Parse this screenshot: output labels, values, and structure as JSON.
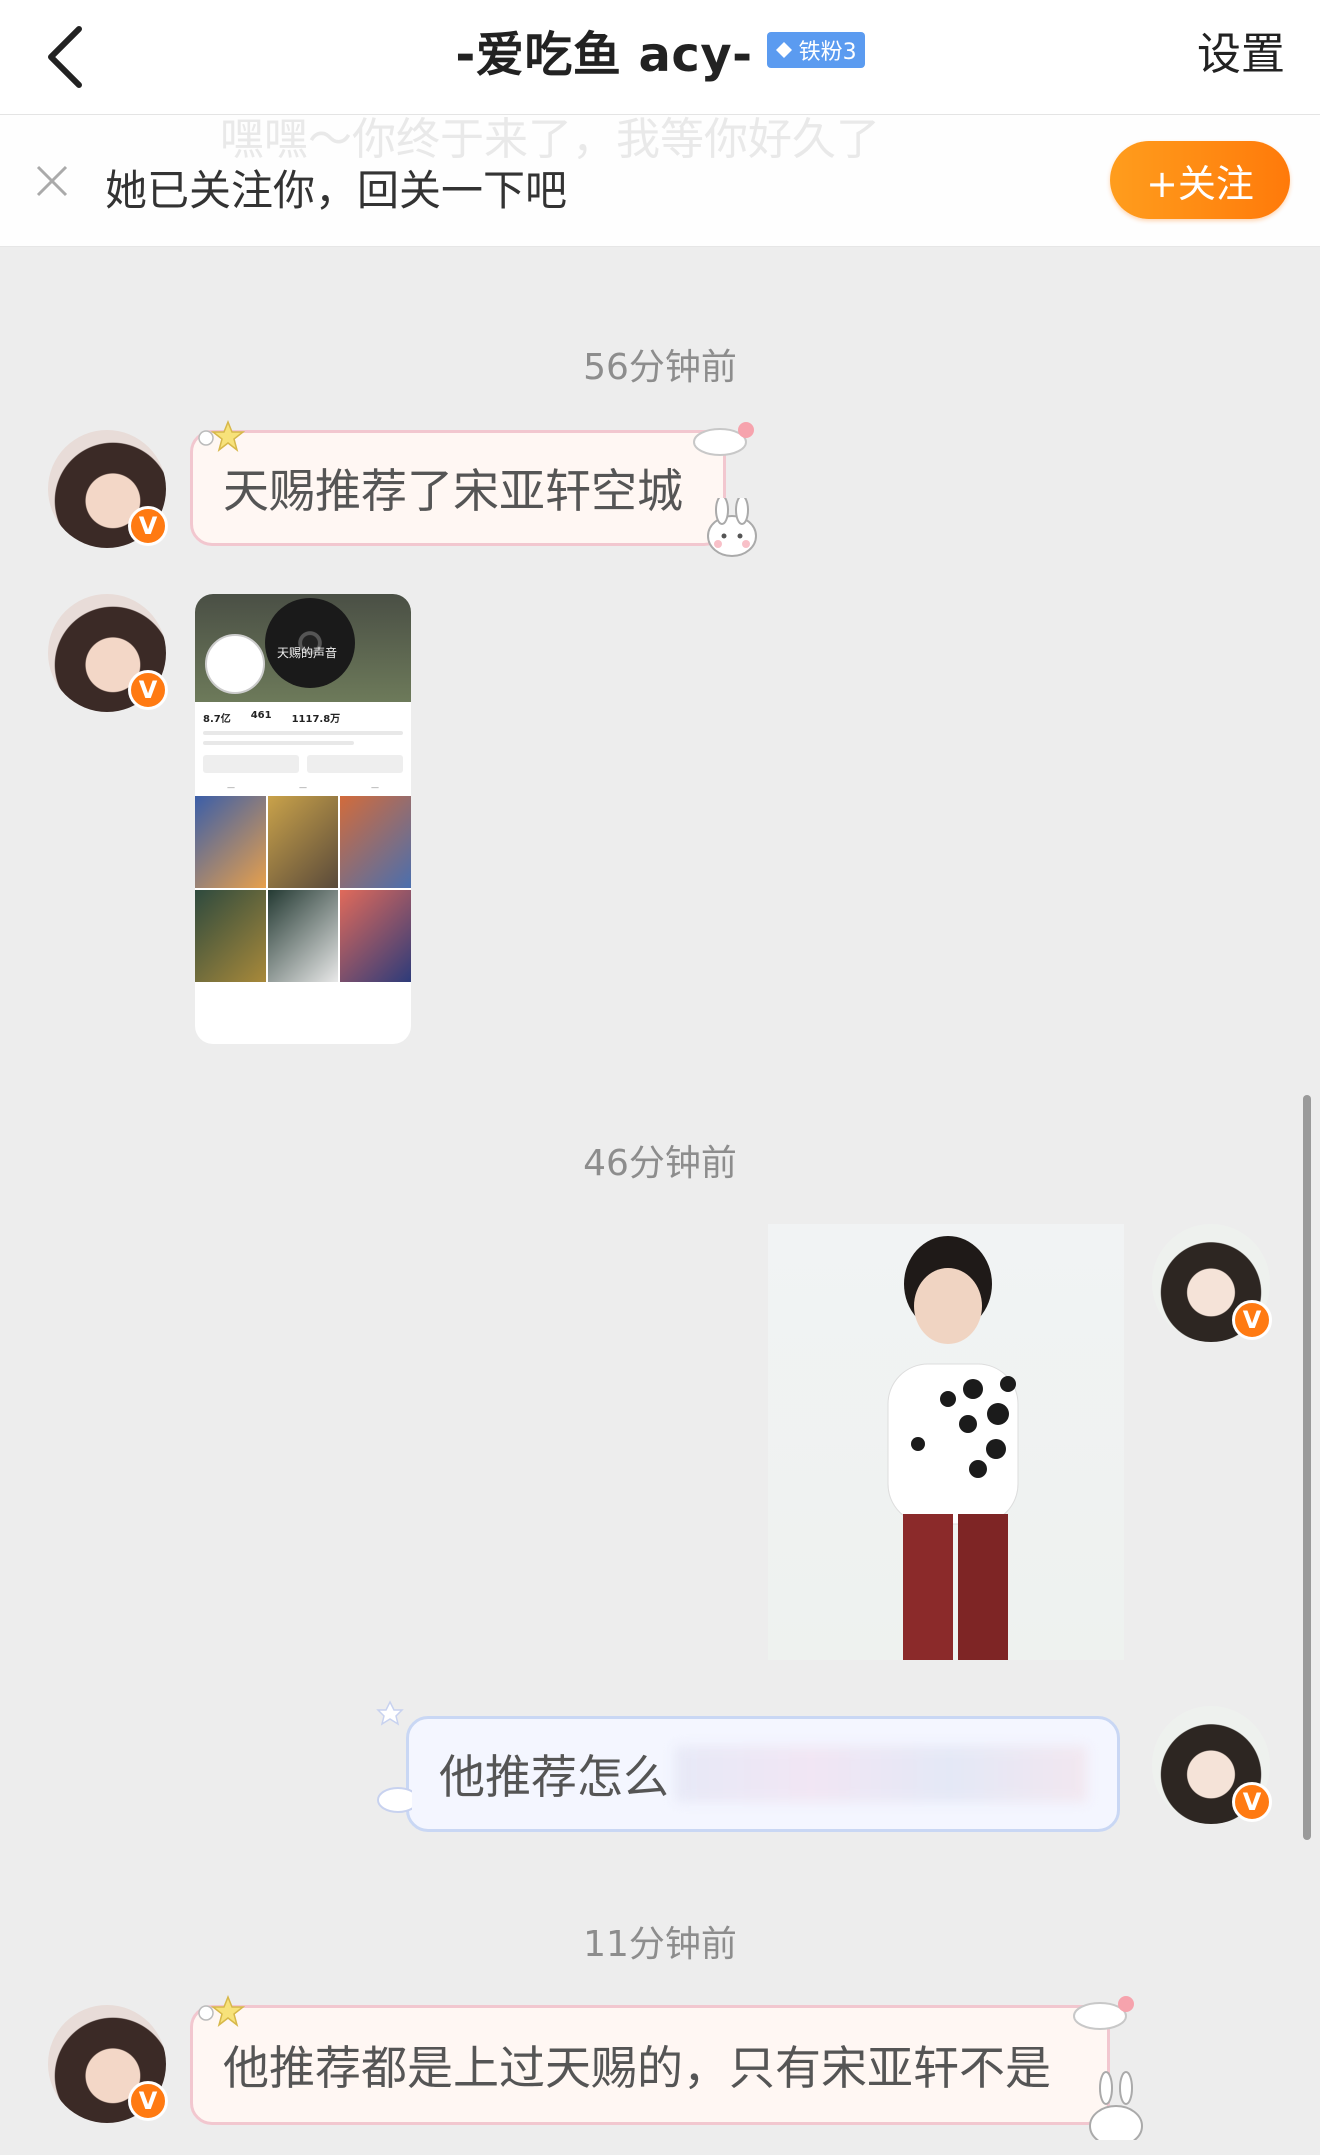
{
  "header": {
    "title": "-爱吃鱼 acy-",
    "fan_badge": "铁粉3",
    "settings_label": "设置"
  },
  "follow_banner": {
    "text": "她已关注你，回关一下吧",
    "follow_label": "+关注",
    "ghost_text": "嘿嘿～你终于来了，我等你好久了"
  },
  "messages": {
    "ts1": "56分钟前",
    "m1_text": "天赐推荐了宋亚轩空城",
    "m2_screenshot": {
      "title": "天赐的声音",
      "stats": [
        "8.7亿",
        "461",
        "1117.8万"
      ]
    },
    "ts2": "46分钟前",
    "m4_text_visible": "他推荐怎么",
    "ts3": "11分钟前",
    "m5_text": "他推荐都是上过天赐的，只有宋亚轩不是"
  },
  "badges": {
    "verified": "V"
  },
  "colors": {
    "accent_orange": "#ff7a12",
    "fan_badge_blue": "#5b9bf0",
    "bubble_pink_border": "#f2c7cf",
    "bubble_blue_border": "#c9d7f4"
  }
}
